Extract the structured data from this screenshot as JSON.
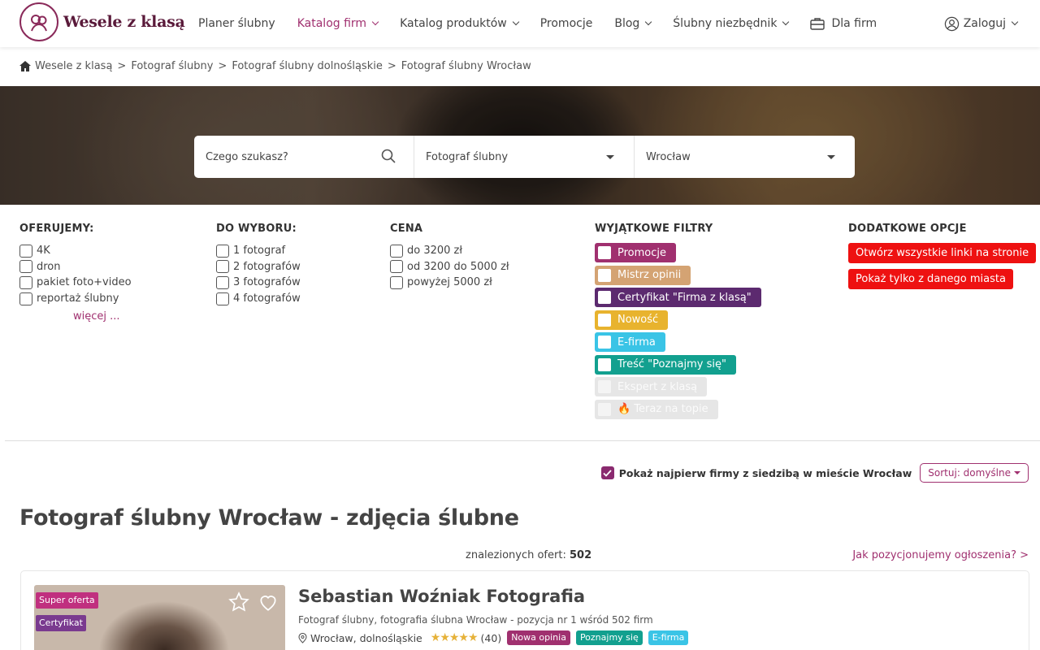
{
  "header": {
    "logo_text": "Wesele z klasą",
    "nav": [
      {
        "label": "Planer ślubny",
        "dropdown": false,
        "active": false
      },
      {
        "label": "Katalog firm",
        "dropdown": true,
        "active": true
      },
      {
        "label": "Katalog produktów",
        "dropdown": true,
        "active": false
      },
      {
        "label": "Promocje",
        "dropdown": false,
        "active": false
      },
      {
        "label": "Blog",
        "dropdown": true,
        "active": false
      },
      {
        "label": "Ślubny niezbędnik",
        "dropdown": true,
        "active": false
      },
      {
        "label": "Dla firm",
        "dropdown": false,
        "active": false
      }
    ],
    "login_label": "Zaloguj"
  },
  "breadcrumb": [
    "Wesele z klasą",
    "Fotograf ślubny",
    "Fotograf ślubny dolnośląskie",
    "Fotograf ślubny Wrocław"
  ],
  "search": {
    "query_placeholder": "Czego szukasz?",
    "category_value": "Fotograf ślubny",
    "city_value": "Wrocław"
  },
  "filters": {
    "oferujemy": {
      "title": "OFERUJEMY:",
      "items": [
        "4K",
        "dron",
        "pakiet foto+video",
        "reportaż ślubny"
      ],
      "more": "więcej ..."
    },
    "do_wyboru": {
      "title": "DO WYBORU:",
      "items": [
        "1 fotograf",
        "2 fotografów",
        "3 fotografów",
        "4 fotografów"
      ]
    },
    "cena": {
      "title": "CENA",
      "items": [
        "do 3200 zł",
        "od 3200 do 5000 zł",
        "powyżej 5000 zł"
      ]
    },
    "wyjatkowe": {
      "title": "WYJĄTKOWE FILTRY",
      "items": [
        {
          "label": "Promocje",
          "color": "#a0306f"
        },
        {
          "label": "Mistrz opinii",
          "color": "#d4a373"
        },
        {
          "label": "Certyfikat \"Firma z klasą\"",
          "color": "#5c2a6f"
        },
        {
          "label": "Nowość",
          "color": "#e8b32e"
        },
        {
          "label": "E-firma",
          "color": "#3ac4e6"
        },
        {
          "label": "Treść \"Poznajmy się\"",
          "color": "#12a08f"
        },
        {
          "label": "Ekspert z klasą",
          "color": "#e6e6e6"
        },
        {
          "label": "🔥 Teraz na topie",
          "color": "#e6e6e6"
        }
      ]
    },
    "dodatkowe": {
      "title": "DODATKOWE OPCJE",
      "buttons": [
        "Otwórz wszystkie linki na stronie",
        "Pokaż tylko z danego miasta"
      ]
    }
  },
  "sort": {
    "first_label": "Pokaż najpierw firmy z siedzibą w mieście Wrocław",
    "sort_label": "Sortuj: domyślne"
  },
  "page_title": "Fotograf ślubny Wrocław - zdjęcia ślubne",
  "results": {
    "found_label": "znalezionych ofert:",
    "found_count": "502",
    "how_link": "Jak pozycjonujemy ogłoszenia? >"
  },
  "listing": {
    "tags": [
      "Super oferta",
      "Certyfikat"
    ],
    "title": "Sebastian Woźniak Fotografia",
    "subtitle": "Fotograf ślubny, fotografia ślubna Wrocław  - pozycja nr 1 wśród 502 firm",
    "location": "Wrocław, dolnośląskie",
    "stars": "★★★★★",
    "reviews": "(40)",
    "badges": [
      {
        "label": "Nowa opinia",
        "color": "#a0306f"
      },
      {
        "label": "Poznajmy się",
        "color": "#12a08f"
      },
      {
        "label": "E-firma",
        "color": "#3ac4e6"
      }
    ]
  }
}
